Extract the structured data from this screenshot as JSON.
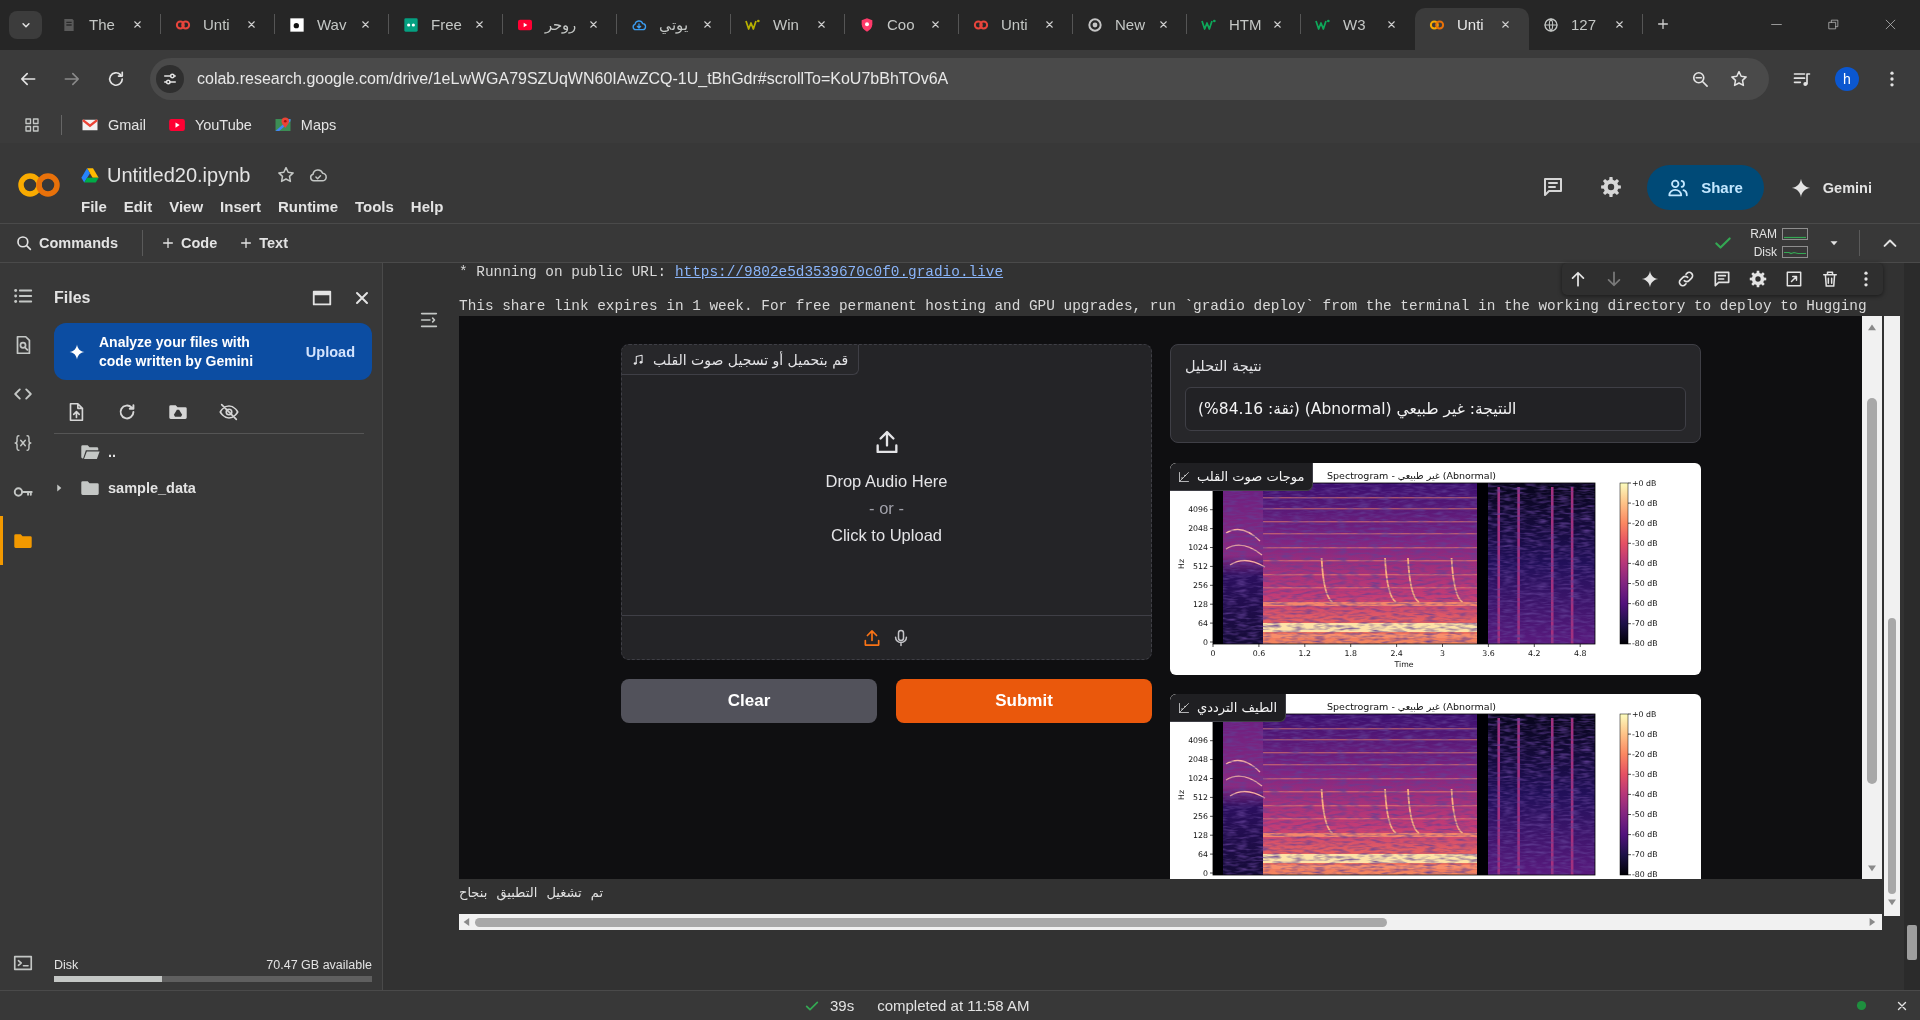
{
  "browser": {
    "tabs": [
      {
        "title": "The",
        "selected": false
      },
      {
        "title": "Unti",
        "selected": false
      },
      {
        "title": "Wav",
        "selected": false
      },
      {
        "title": "Free",
        "selected": false
      },
      {
        "title": "روحر",
        "selected": false
      },
      {
        "title": "يوتي",
        "selected": false
      },
      {
        "title": "Win",
        "selected": false
      },
      {
        "title": "Coo",
        "selected": false
      },
      {
        "title": "Unti",
        "selected": false
      },
      {
        "title": "New",
        "selected": false
      },
      {
        "title": "HTM",
        "selected": false
      },
      {
        "title": "W3",
        "selected": false
      },
      {
        "title": "Unti",
        "selected": true
      },
      {
        "title": "127",
        "selected": false
      }
    ],
    "address": "colab.research.google.com/drive/1eLwWGA79SZUqWN60IAwZCQ-1U_tBhGdr#scrollTo=KoU7bBhTOv6A",
    "profile": "h",
    "bookmarks": [
      "Gmail",
      "YouTube",
      "Maps"
    ]
  },
  "colab": {
    "title": "Untitled20.ipynb",
    "menu": [
      "File",
      "Edit",
      "View",
      "Insert",
      "Runtime",
      "Tools",
      "Help"
    ],
    "share": "Share",
    "gemini": "Gemini",
    "commands": "Commands",
    "add_code": "Code",
    "add_text": "Text",
    "resources": [
      "RAM",
      "Disk"
    ]
  },
  "rail": [
    {
      "selected": false
    },
    {
      "selected": false
    },
    {
      "selected": false
    },
    {
      "selected": false
    },
    {
      "selected": false
    },
    {
      "selected": true
    }
  ],
  "files": {
    "title": "Files",
    "promo": "Analyze your files with code written by Gemini",
    "promo_action": "Upload",
    "items": [
      {
        "name": ".."
      },
      {
        "name": "sample_data",
        "expanded": false
      }
    ],
    "disk": {
      "label": "Disk",
      "reading": "70.47 GB available",
      "level": 0.34
    }
  },
  "cell_toolbar": [
    {
      "disabled": false
    },
    {
      "disabled": true
    },
    {
      "disabled": false
    },
    {
      "disabled": false
    },
    {
      "disabled": false
    },
    {
      "disabled": false
    },
    {
      "disabled": false
    },
    {
      "disabled": false
    },
    {
      "disabled": false
    }
  ],
  "output": {
    "public_url_label": "* Running on public URL:",
    "public_url": "https://9802e5d3539670c0f0.gradio.live",
    "notice": "This share link expires in 1 week. For free permanent hosting and GPU upgrades, run `gradio deploy` from the terminal in the working directory to deploy to Hugging"
  },
  "app": {
    "audio": {
      "label": "قم بتحميل أو تسجيل صوت القلب",
      "drop": "Drop Audio Here",
      "or": "- or -",
      "click": "Click to Upload"
    },
    "buttons": [
      {
        "label": "Clear",
        "kind": "secondary"
      },
      {
        "label": "Submit",
        "kind": "primary"
      }
    ],
    "result": {
      "label": "نتيجة التحليل",
      "value": "النتيجة: غير طبيعي (Abnormal) (ثقة: 84.16%)"
    },
    "plots": [
      {
        "label": "موجات صوت القلب",
        "title": "Spectrogram - غير طبيعي (Abnormal)",
        "ylabel": "Hz",
        "xlabel": "Time",
        "y_ticks": [
          "4096",
          "2048",
          "1024",
          "512",
          "256",
          "128",
          "64",
          "0"
        ],
        "x_ticks": [
          "0",
          "0.6",
          "1.2",
          "1.8",
          "2.4",
          "3",
          "3.6",
          "4.2",
          "4.8"
        ],
        "colorbar_ticks": [
          "+0 dB",
          "-10 dB",
          "-20 dB",
          "-30 dB",
          "-40 dB",
          "-50 dB",
          "-60 dB",
          "-70 dB",
          "-80 dB"
        ]
      },
      {
        "label": "الطيف الترددي",
        "title": "Spectrogram - غير طبيعي (Abnormal)",
        "ylabel": "Hz",
        "y_ticks": [
          "4096",
          "2048",
          "1024",
          "512",
          "256",
          "128",
          "64",
          "0"
        ],
        "colorbar_ticks": [
          "+0 dB",
          "-10 dB",
          "-20 dB",
          "-30 dB",
          "-40 dB",
          "-50 dB",
          "-60 dB",
          "-70 dB",
          "-80 dB"
        ]
      }
    ]
  },
  "log": "تم تشغيل التطبيق بنجاح",
  "status": {
    "elapsed": "39s",
    "message": "completed at 11:58 AM"
  }
}
